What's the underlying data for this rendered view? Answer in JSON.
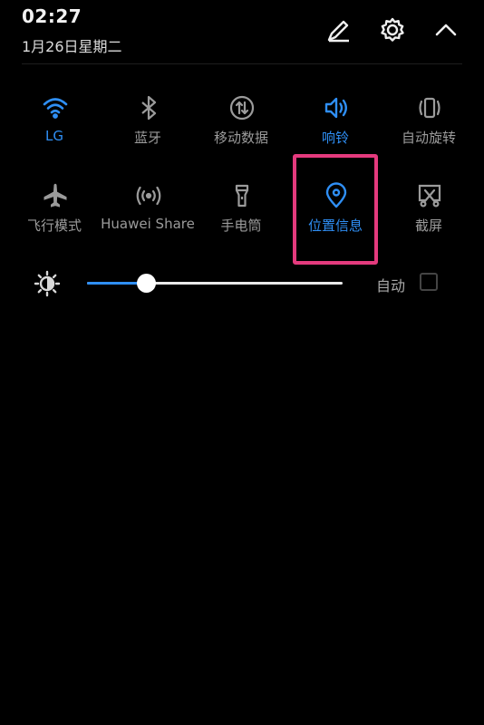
{
  "status": {
    "time": "02:27",
    "date": "1月26日星期二"
  },
  "header_icons": [
    "edit-icon",
    "settings-gear-icon",
    "collapse-chevron-up-icon"
  ],
  "colors": {
    "accent": "#2f8ff5",
    "inactive": "#9b9b9b",
    "highlight": "#e43a7d",
    "background": "#000000"
  },
  "tiles": [
    {
      "label": "LG",
      "icon": "wifi-icon",
      "active": true
    },
    {
      "label": "蓝牙",
      "icon": "bluetooth-icon",
      "active": false
    },
    {
      "label": "移动数据",
      "icon": "mobile-data-icon",
      "active": false
    },
    {
      "label": "响铃",
      "icon": "volume-ring-icon",
      "active": true
    },
    {
      "label": "自动旋转",
      "icon": "auto-rotate-icon",
      "active": false
    },
    {
      "label": "飞行模式",
      "icon": "airplane-icon",
      "active": false
    },
    {
      "label": "Huawei Share",
      "icon": "huawei-share-icon",
      "active": false
    },
    {
      "label": "手电筒",
      "icon": "flashlight-icon",
      "active": false
    },
    {
      "label": "位置信息",
      "icon": "location-pin-icon",
      "active": true,
      "highlighted": true
    },
    {
      "label": "截屏",
      "icon": "screenshot-icon",
      "active": false
    }
  ],
  "brightness": {
    "level": 0.23,
    "auto_label": "自动",
    "auto_checked": false
  }
}
